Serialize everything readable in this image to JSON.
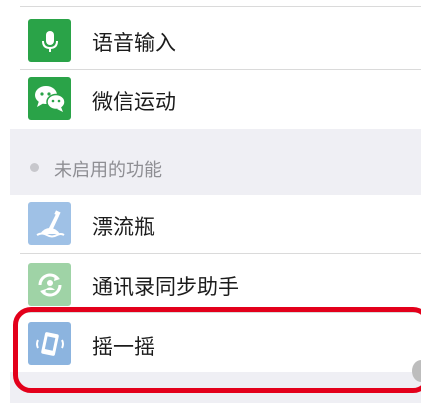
{
  "enabled_features": [
    {
      "label": "语音输入",
      "icon": "microphone-icon",
      "color": "#2aa348"
    },
    {
      "label": "微信运动",
      "icon": "chat-bubbles-icon",
      "color": "#2aa348"
    }
  ],
  "disabled_section": {
    "title": "未启用的功能"
  },
  "disabled_features": [
    {
      "label": "漂流瓶",
      "icon": "drift-bottle-icon",
      "color": "#9fc1e6"
    },
    {
      "label": "通讯录同步助手",
      "icon": "contact-sync-icon",
      "color": "#9fd3a6"
    },
    {
      "label": "摇一摇",
      "icon": "shake-phone-icon",
      "color": "#8cb4df"
    }
  ],
  "colors": {
    "highlight": "#e3001b",
    "section_bg": "#efeff4"
  }
}
